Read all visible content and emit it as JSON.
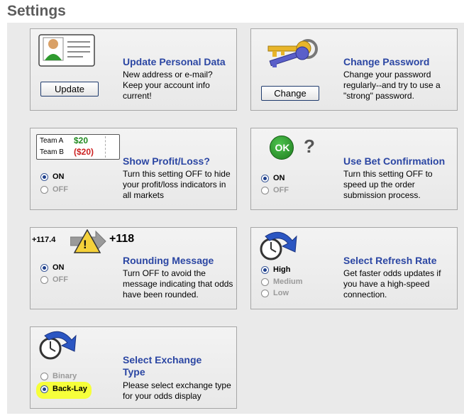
{
  "page": {
    "title": "Settings"
  },
  "colors": {
    "title_blue": "#2b46a3",
    "panel_bg": "#eaeaea",
    "highlight": "#f6ff3a",
    "profit_green": "#1f8a1f",
    "loss_red": "#cc1f1f"
  },
  "cards": {
    "personal": {
      "title": "Update Personal Data",
      "desc": "New address or e-mail? Keep your account info current!",
      "button": "Update",
      "icon": "id-card-icon"
    },
    "password": {
      "title": "Change Password",
      "desc": "Change your password regularly--and try to use a \"strong\" password.",
      "button": "Change",
      "icon": "keys-icon"
    },
    "profit": {
      "title": "Show Profit/Loss?",
      "desc": "Turn this setting OFF to hide your profit/loss indicators in all markets",
      "options": [
        "ON",
        "OFF"
      ],
      "selected": "ON",
      "icon_text": {
        "team_a": "Team A",
        "team_b": "Team B",
        "value_a": "$20",
        "value_b": "($20)"
      }
    },
    "confirm": {
      "title": "Use Bet Confirmation",
      "desc": "Turn this setting OFF to speed up the order submission process.",
      "options": [
        "ON",
        "OFF"
      ],
      "selected": "ON",
      "icon_text": {
        "ok": "OK",
        "question": "?"
      }
    },
    "rounding": {
      "title": "Rounding Message",
      "desc": "Turn OFF to avoid the message indicating that odds have been rounded.",
      "options": [
        "ON",
        "OFF"
      ],
      "selected": "ON",
      "icon_text": {
        "from": "+117.4",
        "to": "+118",
        "warn": "!"
      }
    },
    "refresh": {
      "title": "Select Refresh Rate",
      "desc": "Get faster odds updates if you have a high-speed connection.",
      "options": [
        "High",
        "Medium",
        "Low"
      ],
      "selected": "High",
      "icon": "clock-refresh-icon"
    },
    "exchange": {
      "title": "Select Exchange Type",
      "desc": "Please select exchange type for your odds display",
      "options": [
        "Binary",
        "Back-Lay"
      ],
      "selected": "Back-Lay",
      "icon": "clock-refresh-icon"
    }
  }
}
